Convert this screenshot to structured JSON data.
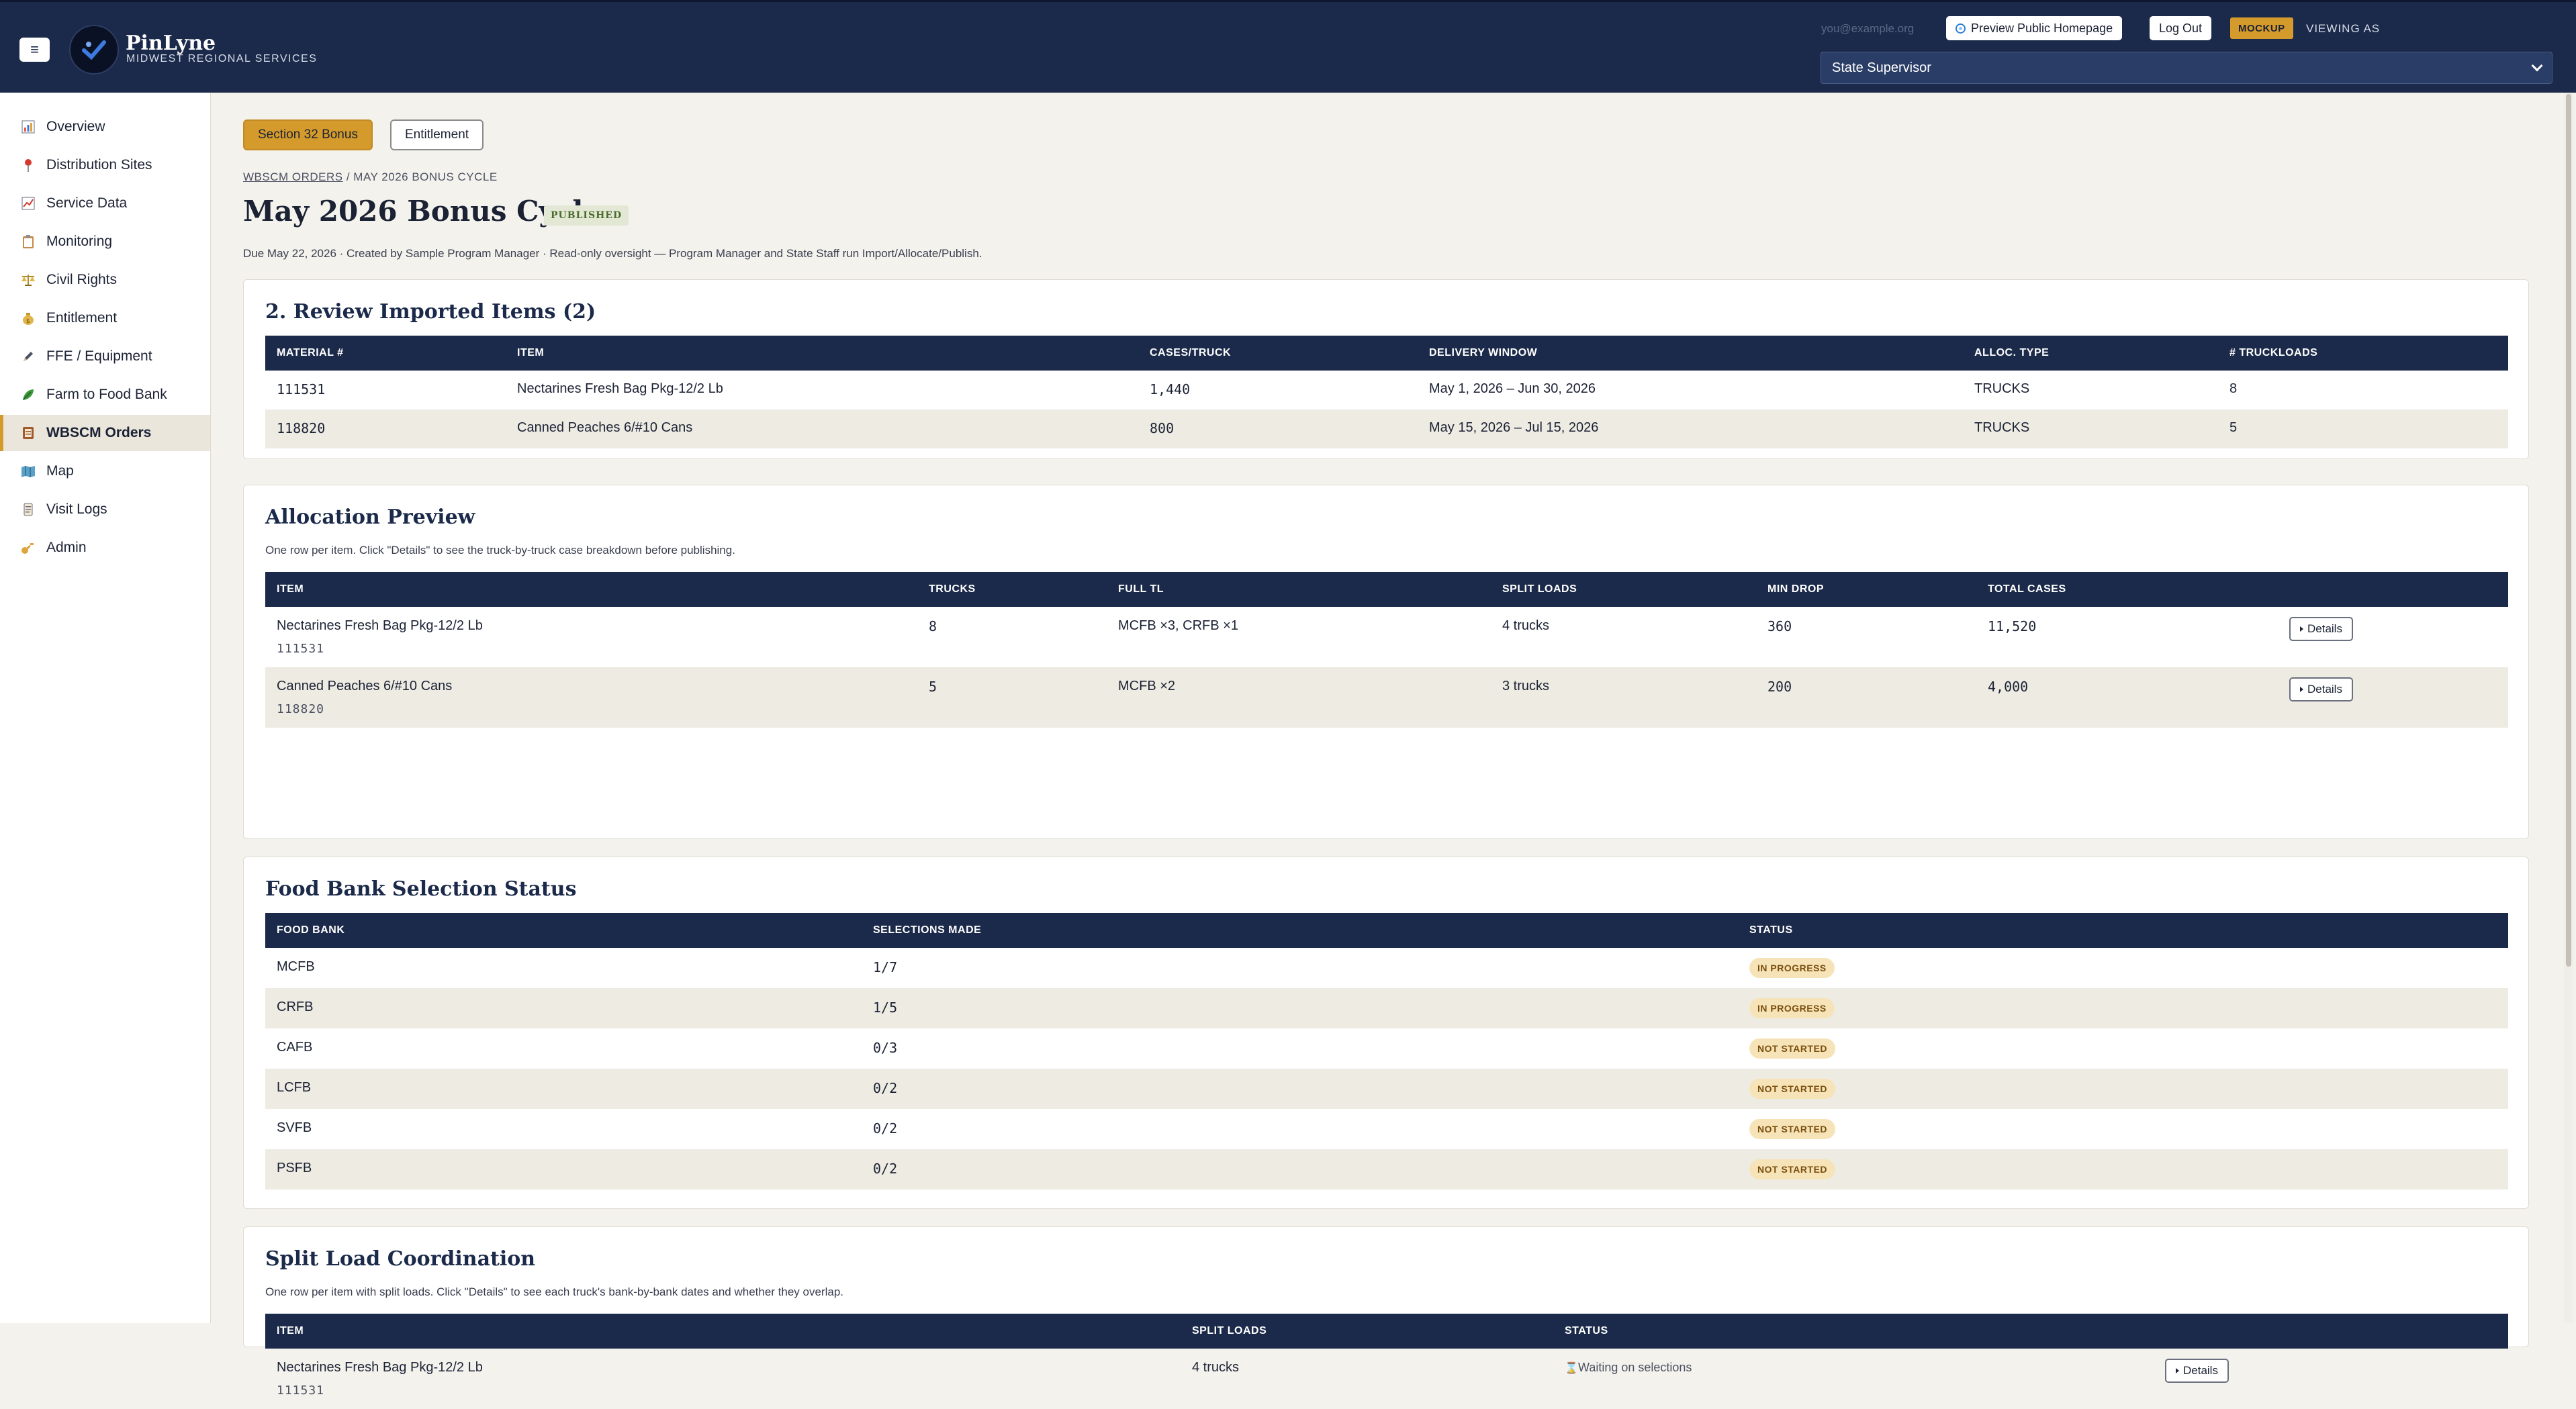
{
  "header": {
    "brand_name": "PinLyne",
    "brand_sub": "MIDWEST REGIONAL SERVICES",
    "user_email": "you@example.org",
    "preview_label": "Preview Public Homepage",
    "logout_label": "Log Out",
    "mockup_badge": "MOCKUP",
    "viewing_as_label": "VIEWING AS",
    "role_selected": "State Supervisor"
  },
  "sidebar": {
    "items": [
      {
        "label": "Overview",
        "icon": "bar-chart-icon"
      },
      {
        "label": "Distribution Sites",
        "icon": "map-pin-icon"
      },
      {
        "label": "Service Data",
        "icon": "line-chart-icon"
      },
      {
        "label": "Monitoring",
        "icon": "clipboard-icon"
      },
      {
        "label": "Civil Rights",
        "icon": "scales-icon"
      },
      {
        "label": "Entitlement",
        "icon": "money-bag-icon"
      },
      {
        "label": "FFE / Equipment",
        "icon": "pencil-icon"
      },
      {
        "label": "Farm to Food Bank",
        "icon": "leaf-icon"
      },
      {
        "label": "WBSCM Orders",
        "icon": "ledger-icon"
      },
      {
        "label": "Map",
        "icon": "map-icon"
      },
      {
        "label": "Visit Logs",
        "icon": "scroll-icon"
      },
      {
        "label": "Admin",
        "icon": "key-icon"
      }
    ],
    "active_index": 8
  },
  "tabs": {
    "bonus": "Section 32 Bonus",
    "entitlement": "Entitlement"
  },
  "breadcrumb": {
    "link": "WBSCM ORDERS",
    "sep": " / ",
    "current": "MAY 2026 BONUS CYCLE"
  },
  "page": {
    "title": "May 2026 Bonus Cycle",
    "status_badge": "PUBLISHED",
    "meta": "Due May 22, 2026 · Created by Sample Program Manager · Read-only oversight — Program Manager and State Staff run Import/Allocate/Publish."
  },
  "review": {
    "title": "2. Review Imported Items (2)",
    "columns": [
      "MATERIAL #",
      "ITEM",
      "CASES/TRUCK",
      "DELIVERY WINDOW",
      "ALLOC. TYPE",
      "# TRUCKLOADS"
    ],
    "rows": [
      [
        "111531",
        "Nectarines Fresh Bag Pkg-12/2 Lb",
        "1,440",
        "May 1, 2026 – Jun 30, 2026",
        "TRUCKS",
        "8"
      ],
      [
        "118820",
        "Canned Peaches 6/#10 Cans",
        "800",
        "May 15, 2026 – Jul 15, 2026",
        "TRUCKS",
        "5"
      ]
    ]
  },
  "allocation": {
    "title": "Allocation Preview",
    "subtitle": "One row per item. Click \"Details\" to see the truck-by-truck case breakdown before publishing.",
    "columns": [
      "ITEM",
      "TRUCKS",
      "FULL TL",
      "SPLIT LOADS",
      "MIN DROP",
      "TOTAL CASES"
    ],
    "details_label": "Details",
    "rows": [
      {
        "item": "Nectarines Fresh Bag Pkg-12/2 Lb",
        "code": "111531",
        "trucks": "8",
        "full_tl": "MCFB ×3, CRFB ×1",
        "split": "4 trucks",
        "min_drop": "360",
        "total": "11,520"
      },
      {
        "item": "Canned Peaches 6/#10 Cans",
        "code": "118820",
        "trucks": "5",
        "full_tl": "MCFB ×2",
        "split": "3 trucks",
        "min_drop": "200",
        "total": "4,000"
      }
    ]
  },
  "foodbank": {
    "title": "Food Bank Selection Status",
    "columns": [
      "FOOD BANK",
      "SELECTIONS MADE",
      "STATUS"
    ],
    "rows": [
      [
        "MCFB",
        "1/7",
        "IN PROGRESS"
      ],
      [
        "CRFB",
        "1/5",
        "IN PROGRESS"
      ],
      [
        "CAFB",
        "0/3",
        "NOT STARTED"
      ],
      [
        "LCFB",
        "0/2",
        "NOT STARTED"
      ],
      [
        "SVFB",
        "0/2",
        "NOT STARTED"
      ],
      [
        "PSFB",
        "0/2",
        "NOT STARTED"
      ]
    ]
  },
  "split": {
    "title": "Split Load Coordination",
    "subtitle": "One row per item with split loads. Click \"Details\" to see each truck's bank-by-bank dates and whether they overlap.",
    "columns": [
      "ITEM",
      "SPLIT LOADS",
      "STATUS"
    ],
    "details_label": "Details",
    "rows": [
      {
        "item": "Nectarines Fresh Bag Pkg-12/2 Lb",
        "code": "111531",
        "split": "4 trucks",
        "status": "Waiting on selections"
      }
    ]
  }
}
